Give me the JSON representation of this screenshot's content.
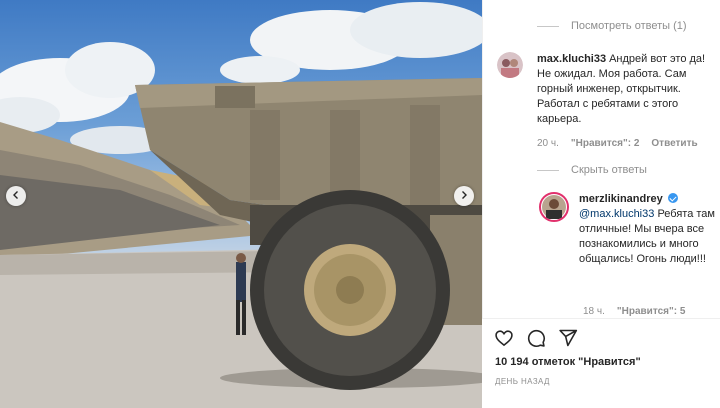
{
  "post": {
    "nav_prev": "prev-arrow",
    "nav_next": "next-arrow"
  },
  "comments": {
    "view_replies_label": "Посмотреть ответы (1)",
    "hide_replies_label": "Скрыть ответы",
    "items": [
      {
        "username": "max.kluchi33",
        "text": "Андрей вот это да! Не ожидал. Моя работа. Сам горный инженер, открытчик. Работал с ребятами с этого карьера.",
        "time": "20 ч.",
        "likes": "\"Нравится\": 2",
        "reply": "Ответить"
      },
      {
        "username": "merzlikinandrey",
        "verified": true,
        "mention": "@max.kluchi33",
        "text": "Ребята там отличные! Мы вчера все познакомились и много общались! Огонь люди!!!",
        "time": "18 ч.",
        "likes": "\"Нравится\": 5"
      }
    ]
  },
  "actions": {
    "like_icon": "heart-icon",
    "comment_icon": "comment-icon",
    "share_icon": "share-icon",
    "likes_count": "10 194 отметок \"Нравится\"",
    "date": "ДЕНЬ НАЗАД"
  },
  "colors": {
    "text": "#262626",
    "muted": "#8e8e8e",
    "link": "#00376b",
    "verified": "#3897f0"
  }
}
